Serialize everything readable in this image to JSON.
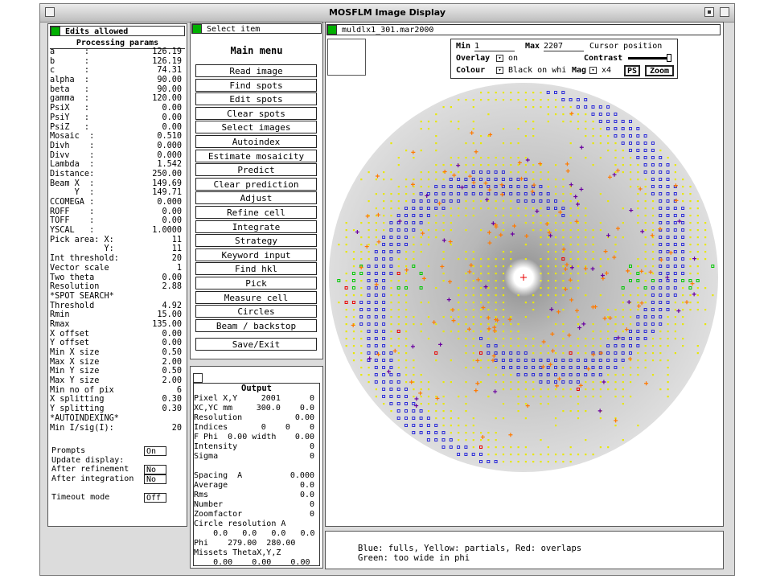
{
  "window": {
    "title": "MOSFLM Image Display"
  },
  "edits": {
    "label": "Edits allowed"
  },
  "params": {
    "header": "Processing params",
    "rows": [
      {
        "k": "a      :",
        "v": "126.19"
      },
      {
        "k": "b      :",
        "v": "126.19"
      },
      {
        "k": "c      :",
        "v": "74.31"
      },
      {
        "k": "alpha  :",
        "v": "90.00"
      },
      {
        "k": "beta   :",
        "v": "90.00"
      },
      {
        "k": "gamma  :",
        "v": "120.00"
      },
      {
        "k": "PsiX   :",
        "v": "0.00"
      },
      {
        "k": "PsiY   :",
        "v": "0.00"
      },
      {
        "k": "PsiZ   :",
        "v": "0.00"
      },
      {
        "k": "Mosaic  :",
        "v": "0.510"
      },
      {
        "k": "Divh    :",
        "v": "0.000"
      },
      {
        "k": "Divv    :",
        "v": "0.000"
      },
      {
        "k": "Lambda  :",
        "v": "1.542"
      },
      {
        "k": "Distance:",
        "v": "250.00"
      },
      {
        "k": "Beam X  :",
        "v": "149.69"
      },
      {
        "k": "     Y  :",
        "v": "149.71"
      },
      {
        "k": "CCOMEGA :",
        "v": "0.000"
      },
      {
        "k": "ROFF    :",
        "v": "0.00"
      },
      {
        "k": "TOFF    :",
        "v": "0.00"
      },
      {
        "k": "YSCAL   :",
        "v": "1.0000"
      },
      {
        "k": "Pick area: X:",
        "v": "11"
      },
      {
        "k": "           Y:",
        "v": "11"
      },
      {
        "k": "Int threshold:",
        "v": "20"
      },
      {
        "k": "Vector scale",
        "v": "1"
      },
      {
        "k": "Two theta",
        "v": "0.00"
      },
      {
        "k": "Resolution",
        "v": "2.88"
      },
      {
        "k": "*SPOT SEARCH*",
        "v": ""
      },
      {
        "k": "Threshold",
        "v": "4.92"
      },
      {
        "k": "Rmin",
        "v": "15.00"
      },
      {
        "k": "Rmax",
        "v": "135.00"
      },
      {
        "k": "X offset",
        "v": "0.00"
      },
      {
        "k": "Y offset",
        "v": "0.00"
      },
      {
        "k": "Min X size",
        "v": "0.50"
      },
      {
        "k": "Max X size",
        "v": "2.00"
      },
      {
        "k": "Min Y size",
        "v": "0.50"
      },
      {
        "k": "Max Y size",
        "v": "2.00"
      },
      {
        "k": "Min no of pix",
        "v": "6"
      },
      {
        "k": "X splitting",
        "v": "0.30"
      },
      {
        "k": "Y splitting",
        "v": "0.30"
      },
      {
        "k": "*AUTOINDEXING*",
        "v": ""
      },
      {
        "k": "Min I/sig(I):",
        "v": "20"
      }
    ],
    "prompts_label": "Prompts",
    "prompts_value": "On",
    "update_display_label": "Update display:",
    "after_refinement_label": "After refinement",
    "after_refinement_value": "No",
    "after_integration_label": "After integration",
    "after_integration_value": "No",
    "timeout_label": "Timeout mode",
    "timeout_value": "Off"
  },
  "menu": {
    "select_item": "Select item",
    "title": "Main menu",
    "buttons": [
      "Read image",
      "Find spots",
      "Edit spots",
      "Clear spots",
      "Select images",
      "Autoindex",
      "Estimate mosaicity",
      "Predict",
      "Clear prediction",
      "Adjust",
      "Refine cell",
      "Integrate",
      "Strategy",
      "Keyword input",
      "Find hkl",
      "Pick",
      "Measure cell",
      "Circles",
      "Beam / backstop"
    ],
    "save_exit": "Save/Exit"
  },
  "output": {
    "title": "Output",
    "rows": [
      {
        "k": "Pixel X,Y",
        "v": "2001      0"
      },
      {
        "k": "XC,YC mm",
        "v": "300.0    0.0"
      },
      {
        "k": "Resolution",
        "v": "0.00"
      },
      {
        "k": "Indices",
        "v": "0    0    0"
      },
      {
        "k": "F Phi  0.00 width",
        "v": "0.00"
      },
      {
        "k": "Intensity",
        "v": "0"
      },
      {
        "k": "Sigma",
        "v": "0"
      },
      {
        "k": "",
        "v": ""
      },
      {
        "k": "Spacing  A",
        "v": "0.000"
      },
      {
        "k": "Average",
        "v": "0.0"
      },
      {
        "k": "Rms",
        "v": "0.0"
      },
      {
        "k": "Number",
        "v": "0"
      },
      {
        "k": "Zoomfactor",
        "v": "0"
      },
      {
        "k": "Circle resolution A",
        "v": ""
      },
      {
        "k": "    0.0   0.0   0.0   0.0",
        "v": ""
      },
      {
        "k": "Phi    279.00  280.00",
        "v": ""
      },
      {
        "k": "Missets ThetaX,Y,Z",
        "v": ""
      },
      {
        "k": "    0.00    0.00    0.00",
        "v": ""
      }
    ]
  },
  "image": {
    "filename": "muldlx1_301.mar2000",
    "min_label": "Min",
    "min_value": "1",
    "max_label": "Max",
    "max_value": "2207",
    "cursor_label": "Cursor position",
    "overlay_label": "Overlay",
    "overlay_value": "on",
    "contrast_label": "Contrast",
    "colour_label": "Colour",
    "colour_value": "Black on whi",
    "mag_label": "Mag",
    "mag_value": "x4",
    "ps_label": "PS",
    "zoom_label": "Zoom",
    "legend_line1": "Blue: fulls, Yellow: partials, Red: overlaps",
    "legend_line2": "Green: too wide in phi"
  },
  "colors": {
    "full": "#2a2ad8",
    "partial": "#e8e800",
    "overlap": "#e80000",
    "wide": "#00c800",
    "predicted": "#ff7a00",
    "indexed": "#6a00a0"
  }
}
